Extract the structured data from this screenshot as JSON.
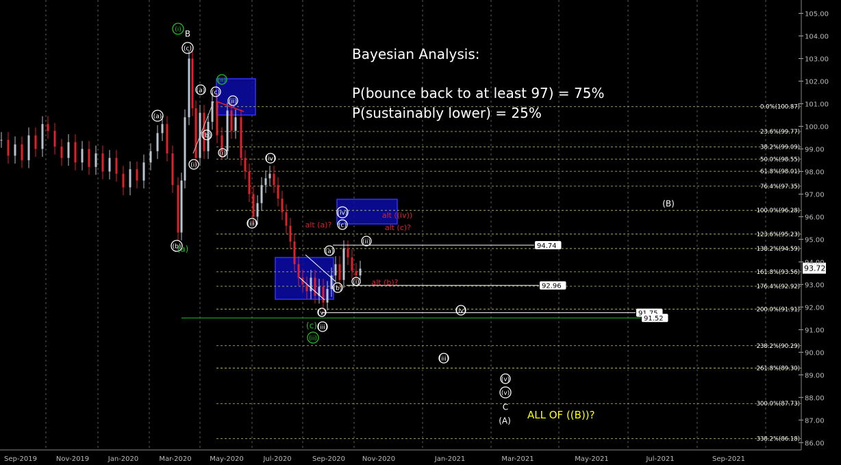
{
  "chart_data": {
    "type": "candlestick",
    "instrument_scale": "price",
    "ylim": [
      85.7,
      105.3
    ],
    "y_ticks": [
      "105.00",
      "104.00",
      "103.00",
      "102.00",
      "101.00",
      "100.00",
      "99.00",
      "98.00",
      "97.00",
      "96.00",
      "95.00",
      "94.00",
      "93.00",
      "92.00",
      "91.00",
      "90.00",
      "89.00",
      "88.00",
      "87.00",
      "86.00"
    ],
    "x_ticks": [
      "Sep-2019",
      "Nov-2019",
      "Jan-2020",
      "Mar-2020",
      "May-2020",
      "Jul-2020",
      "Sep-2020",
      "Nov-2020",
      "Jan-2021",
      "Mar-2021",
      "May-2021",
      "Jul-2021",
      "Sep-2021"
    ],
    "last_price_label": "93.72",
    "fib_levels": [
      {
        "label": "0.0%(100.87)",
        "value": 100.87
      },
      {
        "label": "23.6%(99.77)",
        "value": 99.77
      },
      {
        "label": "38.2%(99.09)",
        "value": 99.09
      },
      {
        "label": "50.0%(98.55)",
        "value": 98.55
      },
      {
        "label": "61.8%(98.01)",
        "value": 98.01
      },
      {
        "label": "76.4%(97.35)",
        "value": 97.35
      },
      {
        "label": "100.0%(96.28)",
        "value": 96.28
      },
      {
        "label": "123.6%(95.23)",
        "value": 95.23
      },
      {
        "label": "138.2%(94.59)",
        "value": 94.59
      },
      {
        "label": "161.8%(93.56)",
        "value": 93.56
      },
      {
        "label": "176.4%(92.92)",
        "value": 92.92
      },
      {
        "label": "200.0%(91.91)",
        "value": 91.91
      },
      {
        "label": "238.2%(90.29)",
        "value": 90.29
      },
      {
        "label": "261.8%(89.30)",
        "value": 89.3
      },
      {
        "label": "300.0%(87.73)",
        "value": 87.73
      },
      {
        "label": "338.2%(86.18)",
        "value": 86.18
      }
    ],
    "horizontal_lines": [
      {
        "label": "94.74",
        "value": 94.74
      },
      {
        "label": "92.96",
        "value": 92.96
      },
      {
        "label": "91.75",
        "value": 91.75
      },
      {
        "label": "91.52",
        "value": 91.52
      }
    ],
    "analysis_text": {
      "heading": "Bayesian Analysis:",
      "line1": "P(bounce back to at least 97) = 75%",
      "line2": "P(sustainably lower) = 25%"
    },
    "yellow_note": "ALL OF ((B))?",
    "wave_labels_white": [
      "B",
      "(c)",
      "(a)",
      "(b)",
      "(i)",
      "(c)",
      "(ii)",
      "(i)",
      "(iv)",
      "(iii)",
      "(a)",
      "(b)",
      "(v)",
      "(iii)",
      "(iv)",
      "(c)",
      "(ii)",
      "(i)",
      "(a)",
      "(b)",
      "(iv)",
      "(iii)",
      "(v)",
      "(v)",
      "C",
      "(A)",
      "(B)",
      "(a)",
      "(c)",
      "(b)"
    ],
    "wave_labels_green": [
      "(i)",
      "(ii)",
      "(a)",
      "(c)",
      "(ii)"
    ],
    "wave_labels_red": [
      "alt (a)?",
      "alt ((iv))",
      "alt (c)?",
      "alt (b)?"
    ],
    "colors": {
      "background": "#000000",
      "up_candle": "#b8c4d0",
      "down_candle": "#e0202a",
      "grid": "#5a5a5a",
      "fib_line": "#c9c96a",
      "green_line": "#21c321",
      "box_fill": "#0c0ca8",
      "box_stroke": "#3030ff",
      "yellow_text": "#ffff00",
      "red_text": "#e0202a"
    }
  }
}
